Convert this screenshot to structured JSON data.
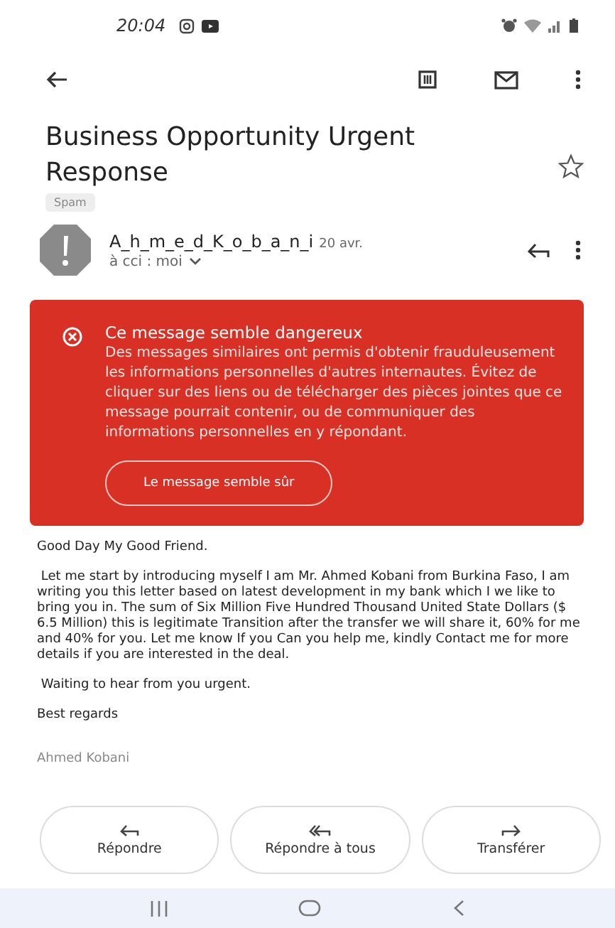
{
  "status_bar": {
    "time": "20:04"
  },
  "email": {
    "subject": "Business Opportunity Urgent Response",
    "label": "Spam",
    "starred": false,
    "sender": {
      "name": "A_h_m_e_d_K_o_b_a_n_i",
      "date": "20 avr.",
      "recipients": "à cci : moi"
    },
    "warning": {
      "title": "Ce message semble dangereux",
      "text": "Des messages similaires ont permis d'obtenir frauduleusement les informations personnelles d'autres internautes. Évitez de cliquer sur des liens ou de télécharger des pièces jointes que ce message pourrait contenir, ou de communiquer des informations personnelles en y répondant.",
      "button": "Le message semble sûr"
    },
    "body": [
      {
        "kind": "text",
        "text": "Good Day My Good Friend."
      },
      {
        "kind": "text",
        "text": " Let me start by introducing myself I am Mr. Ahmed Kobani from Burkina Faso, I am writing you this letter based on latest development in my bank which I we like to bring you in. The sum of Six Million Five Hundred Thousand United State Dollars ($ 6.5 Million) this is legitimate Transition after the transfer we will share it, 60% for me and 40% for you. Let me know If you Can you help me, kindly Contact me for more details if you are interested in the deal."
      },
      {
        "kind": "text",
        "text": " Waiting to hear from you urgent."
      },
      {
        "kind": "text",
        "text": "Best regards"
      },
      {
        "kind": "signature",
        "text": "Ahmed Kobani"
      }
    ]
  },
  "actions": [
    {
      "kind": "reply",
      "label": "Répondre"
    },
    {
      "kind": "reply_all",
      "label": "Répondre à tous"
    },
    {
      "kind": "forward",
      "label": "Transférer"
    }
  ]
}
